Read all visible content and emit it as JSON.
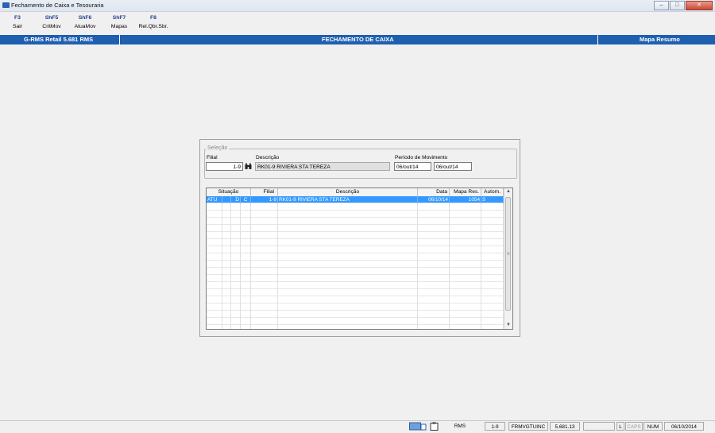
{
  "window": {
    "title": "Fechamento de Caixa e Tesouraria"
  },
  "toolbar": [
    {
      "key": "F3",
      "label": "Sair"
    },
    {
      "key": "ShF5",
      "label": "CritMov"
    },
    {
      "key": "ShF6",
      "label": "AtuaMov"
    },
    {
      "key": "ShF7",
      "label": "Mapas"
    },
    {
      "key": "F8",
      "label": "Rel.Qbr.Sbr."
    }
  ],
  "header": {
    "left": "G-RMS Retail 5.681 RMS",
    "center": "FECHAMENTO DE CAIXA",
    "right": "Mapa Resumo"
  },
  "selecao": {
    "legend": "Seleção",
    "filial_label": "Filial",
    "filial_value": "1-9",
    "descricao_label": "Descrição",
    "descricao_value": "RK01-9 RIVIERA STA TEREZA",
    "periodo_label": "Período de Movimento",
    "periodo_inicio": "06/out/14",
    "periodo_fim": "06/out/14"
  },
  "grid": {
    "headers": {
      "situacao": "Situação",
      "filial": "Filial",
      "descricao": "Descrição",
      "data": "Data",
      "mapa": "Mapa Res.",
      "autom": "Autom."
    },
    "rows": [
      {
        "sit1": "ATU",
        "sit2": "",
        "sit3": "D",
        "sit4": "C",
        "filial": "1-9",
        "descricao": "RK01-9 RIVIERA STA TEREZA",
        "data": "06/10/14",
        "mapa": "1054",
        "autom": "S"
      }
    ]
  },
  "statusbar": {
    "system": "RMS",
    "filial": "1-9",
    "program": "FRMVGTUINC",
    "version": "5.681.13",
    "l": "L",
    "caps": "CAPS",
    "num": "NUM",
    "date": "06/10/2014"
  }
}
